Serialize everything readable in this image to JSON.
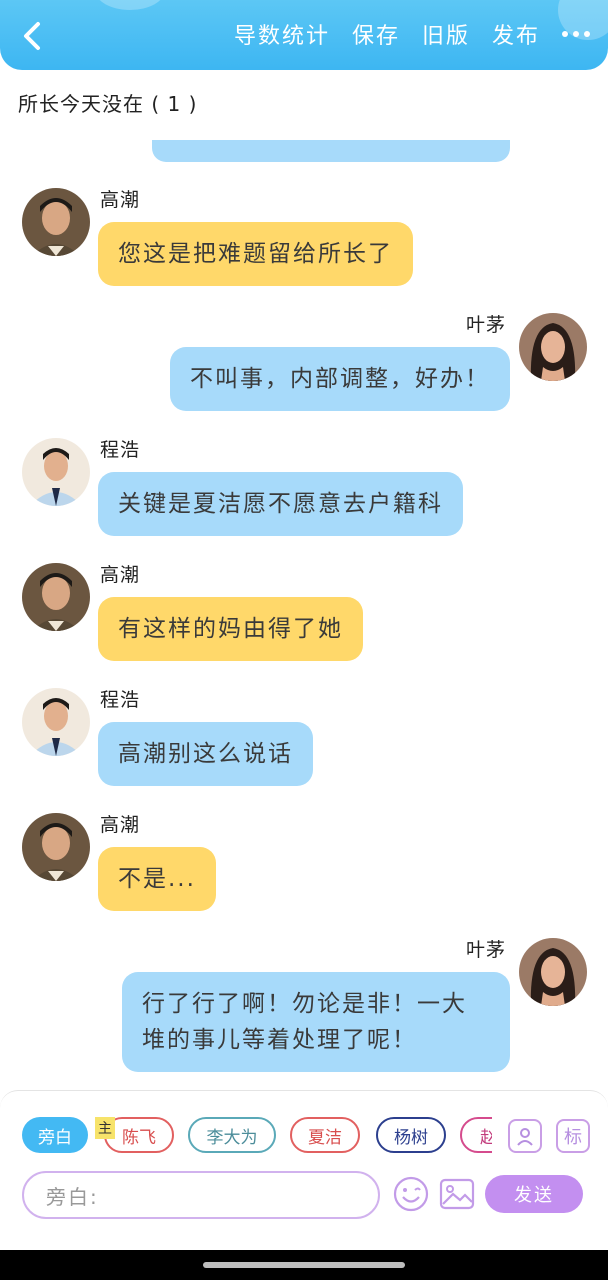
{
  "header": {
    "back_label": "<",
    "actions": [
      "导数统计",
      "保存",
      "旧版",
      "发布"
    ],
    "more_label": "更多"
  },
  "chat": {
    "title": "所长今天没在 ( 1 )",
    "messages": [
      {
        "sender": "高潮",
        "side": "left",
        "color": "yellow",
        "text": "您这是把难题留给所长了"
      },
      {
        "sender": "叶茅",
        "side": "right",
        "color": "blue",
        "text": "不叫事，内部调整，好办！"
      },
      {
        "sender": "程浩",
        "side": "left",
        "color": "blue",
        "text": "关键是夏洁愿不愿意去户籍科"
      },
      {
        "sender": "高潮",
        "side": "left",
        "color": "yellow",
        "text": "有这样的妈由得了她"
      },
      {
        "sender": "程浩",
        "side": "left",
        "color": "blue",
        "text": "高潮别这么说话"
      },
      {
        "sender": "高潮",
        "side": "left",
        "color": "yellow",
        "text": "不是..."
      },
      {
        "sender": "叶茅",
        "side": "right",
        "color": "blue",
        "text_line1": "行了行了啊！勿论是非！一大",
        "text_line2": "堆的事儿等着处理了呢！"
      }
    ]
  },
  "composer": {
    "chips": [
      "旁白",
      "陈飞",
      "李大为",
      "夏洁",
      "杨树",
      "赵"
    ],
    "main_badge": "主",
    "input_placeholder": "旁白:",
    "send_label": "发送",
    "contact_icon": "contact-icon",
    "tag_label": "标"
  },
  "colors": {
    "header_blue": "#3db6f2",
    "bubble_yellow": "#ffd86a",
    "bubble_blue": "#a7dafa",
    "send_purple": "#c38ff0"
  }
}
